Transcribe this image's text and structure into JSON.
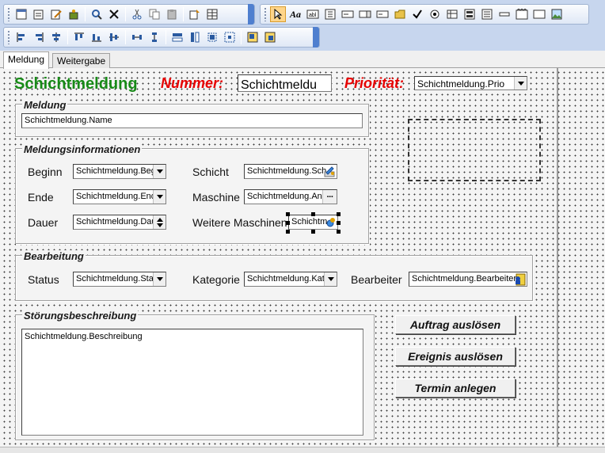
{
  "tabs": [
    {
      "label": "Meldung",
      "selected": true
    },
    {
      "label": "Weitergabe",
      "selected": false
    }
  ],
  "header": {
    "title": "Schichtmeldung",
    "number_label": "Nummer:",
    "number_value": "Schichtmeldu",
    "priority_label": "Priorität:",
    "priority_value": "Schichtmeldung.Prio"
  },
  "meldung_group": {
    "title": "Meldung",
    "name_value": "Schichtmeldung.Name"
  },
  "info_group": {
    "title": "Meldungsinformationen",
    "begin_label": "Beginn",
    "begin_value": "Schichtmeldung.Beg",
    "end_label": "Ende",
    "end_value": "Schichtmeldung.Ende",
    "duration_label": "Dauer",
    "duration_value": "Schichtmeldung.Dau",
    "shift_label": "Schicht",
    "shift_value": "Schichtmeldung.Sch",
    "machine_label": "Maschine",
    "machine_value": "Schichtmeldung.Anl",
    "more_machines_label": "Weitere Maschinen",
    "more_machines_value": "Schichtm"
  },
  "processing_group": {
    "title": "Bearbeitung",
    "status_label": "Status",
    "status_value": "Schichtmeldung.Stat",
    "category_label": "Kategorie",
    "category_value": "Schichtmeldung.Kate",
    "editor_label": "Bearbeiter",
    "editor_value": "Schichtmeldung.Bearbeiter"
  },
  "description_group": {
    "title": "Störungsbeschreibung",
    "description_value": "Schichtmeldung.Beschreibung"
  },
  "actions": {
    "order_label": "Auftrag auslösen",
    "event_label": "Ereignis auslösen",
    "appointment_label": "Termin anlegen"
  },
  "toolbar": {
    "icons_row1": [
      "new-form-icon",
      "form-wizard-icon",
      "edit-icon",
      "properties-icon",
      "find-icon",
      "delete-icon",
      "cut-icon",
      "copy-icon",
      "paste-icon",
      "import-icon",
      "grid-icon",
      "pointer-icon",
      "text-icon",
      "label-icon",
      "field-icon",
      "listbox-icon",
      "combobox-icon",
      "date-icon",
      "folder-icon",
      "checkbox-icon",
      "radio-icon",
      "table-icon",
      "subform-icon",
      "memo-icon",
      "line-icon",
      "frame-icon",
      "rectangle-icon",
      "picture-icon"
    ],
    "icons_row2": [
      "align-left-icon",
      "align-right-icon",
      "align-center-icon",
      "align-top-icon",
      "align-bottom-icon",
      "align-middle-icon",
      "space-horizontal-icon",
      "space-vertical-icon",
      "same-width-icon",
      "same-height-icon",
      "same-size-icon",
      "center-icon",
      "bring-front-icon",
      "send-back-icon"
    ]
  },
  "colors": {
    "accent_green": "#178a17",
    "accent_red": "#e60000",
    "toolbar_blue": "#4f7fcf"
  }
}
